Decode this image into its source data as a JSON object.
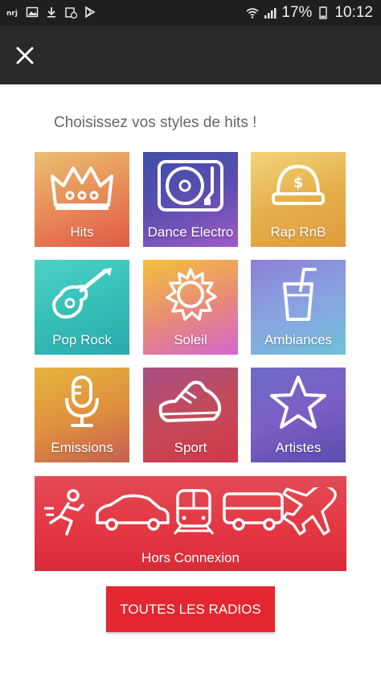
{
  "status_bar": {
    "battery_percent": "17%",
    "time": "10:12",
    "left_icons": [
      "nrj-app-icon",
      "image-icon",
      "download-icon",
      "calendar-icon",
      "playstore-icon"
    ],
    "right_icons": [
      "wifi-icon",
      "signal-icon",
      "battery-icon"
    ]
  },
  "toolbar": {
    "close_icon": "close-icon"
  },
  "heading": "Choisissez vos styles de hits !",
  "tiles": [
    {
      "label": "Hits",
      "icon": "crown-icon"
    },
    {
      "label": "Dance Electro",
      "icon": "turntable-icon"
    },
    {
      "label": "Rap RnB",
      "icon": "cap-icon"
    },
    {
      "label": "Pop Rock",
      "icon": "guitar-icon"
    },
    {
      "label": "Soleil",
      "icon": "sun-icon"
    },
    {
      "label": "Ambiances",
      "icon": "drink-icon"
    },
    {
      "label": "Emissions",
      "icon": "microphone-icon"
    },
    {
      "label": "Sport",
      "icon": "sneaker-icon"
    },
    {
      "label": "Artistes",
      "icon": "star-icon"
    }
  ],
  "offline_tile": {
    "label": "Hors Connexion",
    "icons": [
      "runner-icon",
      "car-icon",
      "train-icon",
      "bus-icon",
      "plane-icon"
    ]
  },
  "all_radios_button": "TOUTES LES RADIOS",
  "colors": {
    "accent_red": "#e3262f",
    "toolbar": "#2a2a2a",
    "statusbar": "#1f1f1f"
  }
}
